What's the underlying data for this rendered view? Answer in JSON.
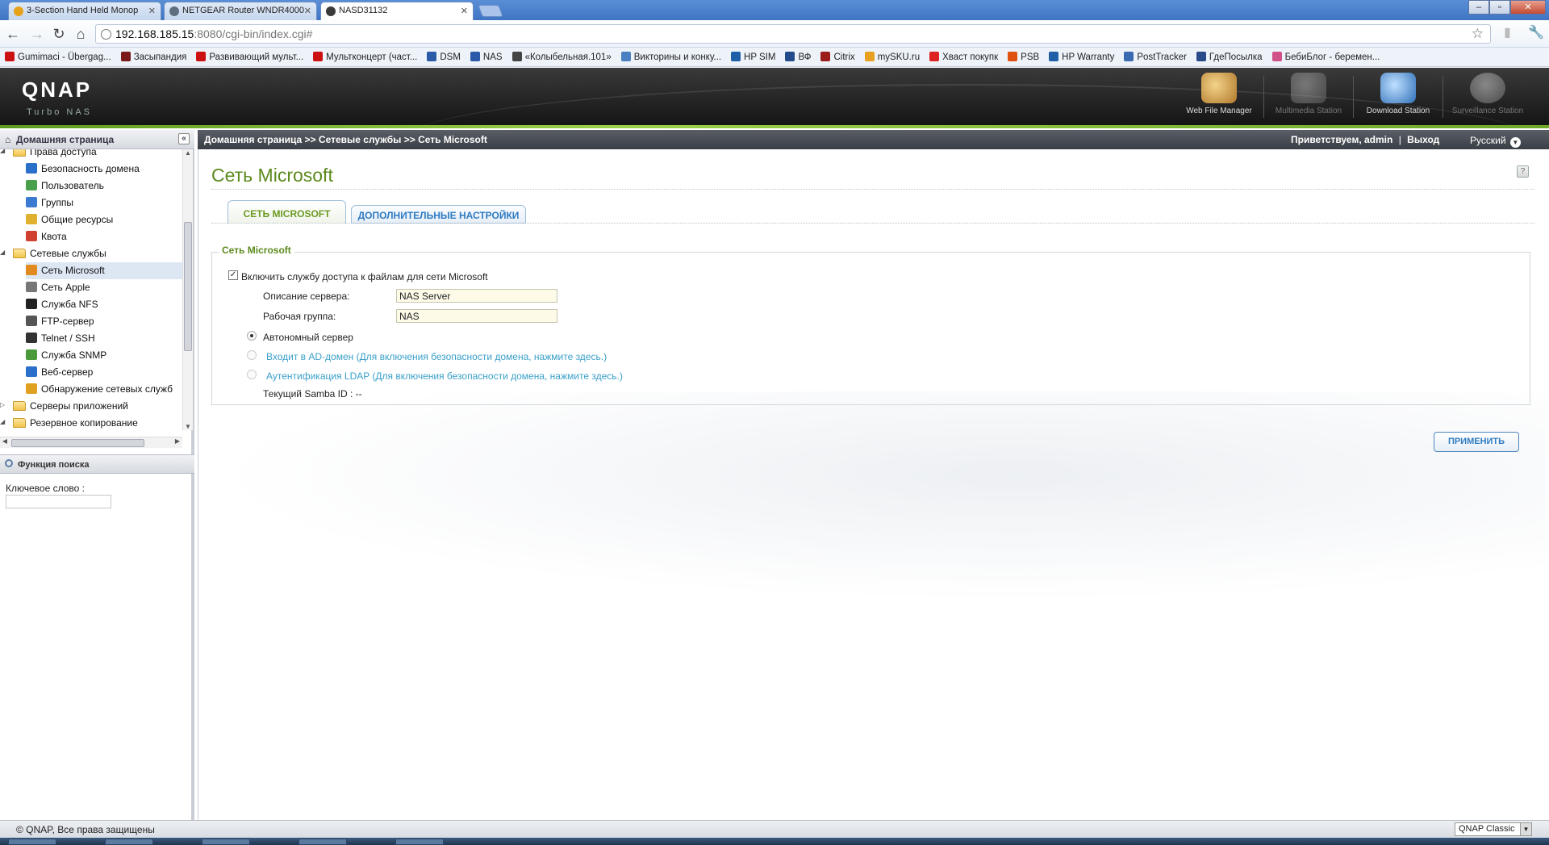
{
  "browser": {
    "tabs": [
      {
        "title": "3-Section Hand Held Monop",
        "icon_color": "#e7a21c"
      },
      {
        "title": "NETGEAR Router WNDR4000",
        "icon_color": "#5f6f80"
      },
      {
        "title": "NASD31132",
        "icon_color": "#3a3a3a"
      }
    ],
    "url_host": "192.168.185.15",
    "url_rest": ":8080/cgi-bin/index.cgi#",
    "bookmarks": [
      {
        "label": "Gumimaci - Übergag...",
        "icon_color": "#cc1111"
      },
      {
        "label": "Засыпандия",
        "icon_color": "#7a1a1a"
      },
      {
        "label": "Развивающий мульт...",
        "icon_color": "#cc1111"
      },
      {
        "label": "Мультконцерт (част...",
        "icon_color": "#cc1111"
      },
      {
        "label": "DSM",
        "icon_color": "#2a5aa8"
      },
      {
        "label": "NAS",
        "icon_color": "#2a5aa8"
      },
      {
        "label": "«Колыбельная.101»",
        "icon_color": "#444444"
      },
      {
        "label": "Викторины и конку...",
        "icon_color": "#4a7fc1"
      },
      {
        "label": "HP SIM",
        "icon_color": "#1f5fa8"
      },
      {
        "label": "ВФ",
        "icon_color": "#234a8a"
      },
      {
        "label": "Citrix",
        "icon_color": "#9c1c1c"
      },
      {
        "label": "mySKU.ru",
        "icon_color": "#e8a020"
      },
      {
        "label": "Хваст покупк",
        "icon_color": "#dd2222"
      },
      {
        "label": "PSB",
        "icon_color": "#e05010"
      },
      {
        "label": "HP Warranty",
        "icon_color": "#1f5fa8"
      },
      {
        "label": "PostTracker",
        "icon_color": "#3a6ab0"
      },
      {
        "label": "ГдеПосылка",
        "icon_color": "#2a4a8a"
      },
      {
        "label": "БебиБлог - беремен...",
        "icon_color": "#d0508a"
      }
    ]
  },
  "qnap": {
    "logo": "QNAP",
    "sub": "Turbo NAS",
    "apps": [
      {
        "label": "Web File Manager",
        "dim": false,
        "color": "#d9a441"
      },
      {
        "label": "Multimedia Station",
        "dim": true,
        "color": "#8a8a8a"
      },
      {
        "label": "Download Station",
        "dim": false,
        "color": "#4a90d9"
      },
      {
        "label": "Surveillance Station",
        "dim": true,
        "color": "#9a9a9a"
      }
    ]
  },
  "left": {
    "home": "Домашняя страница",
    "tree": [
      {
        "label": "Права доступа",
        "type": "folder",
        "level": 0,
        "expanded": true
      },
      {
        "label": "Безопасность домена",
        "type": "item",
        "level": 1,
        "icon_color": "#2a6fc9"
      },
      {
        "label": "Пользователь",
        "type": "item",
        "level": 1,
        "icon_color": "#4aa04a"
      },
      {
        "label": "Группы",
        "type": "item",
        "level": 1,
        "icon_color": "#3a7ad0"
      },
      {
        "label": "Общие ресурсы",
        "type": "item",
        "level": 1,
        "icon_color": "#e0b030"
      },
      {
        "label": "Квота",
        "type": "item",
        "level": 1,
        "icon_color": "#d04030"
      },
      {
        "label": "Сетевые службы",
        "type": "folder",
        "level": 0,
        "expanded": true
      },
      {
        "label": "Сеть Microsoft",
        "type": "item",
        "level": 1,
        "icon_color": "#e08a20",
        "selected": true
      },
      {
        "label": "Сеть Apple",
        "type": "item",
        "level": 1,
        "icon_color": "#777777"
      },
      {
        "label": "Служба NFS",
        "type": "item",
        "level": 1,
        "icon_color": "#222222"
      },
      {
        "label": "FTP-сервер",
        "type": "item",
        "level": 1,
        "icon_color": "#555555"
      },
      {
        "label": "Telnet / SSH",
        "type": "item",
        "level": 1,
        "icon_color": "#333333"
      },
      {
        "label": "Служба SNMP",
        "type": "item",
        "level": 1,
        "icon_color": "#4a9a3a"
      },
      {
        "label": "Веб-сервер",
        "type": "item",
        "level": 1,
        "icon_color": "#2a6fc9"
      },
      {
        "label": "Обнаружение сетевых служб",
        "type": "item",
        "level": 1,
        "icon_color": "#e0a020"
      },
      {
        "label": "Серверы приложений",
        "type": "folder",
        "level": 0,
        "expanded": false
      },
      {
        "label": "Резервное копирование",
        "type": "folder",
        "level": 0,
        "expanded": true
      }
    ],
    "search_title": "Функция поиска",
    "keyword_label": "Ключевое слово :",
    "keyword_value": ""
  },
  "header": {
    "breadcrumb": "Домашняя страница >> Сетевые службы >> Сеть Microsoft",
    "greeting": "Приветствуем,",
    "user": "admin",
    "separator": "|",
    "logout": "Выход",
    "language": "Русский"
  },
  "main": {
    "title": "Сеть Microsoft",
    "help": "?",
    "tabs": [
      {
        "label": "СЕТЬ MICROSOFT",
        "active": true
      },
      {
        "label": "ДОПОЛНИТЕЛЬНЫЕ НАСТРОЙКИ",
        "active": false
      }
    ],
    "section_title": "Сеть Microsoft",
    "enable_label": "Включить службу доступа к файлам для сети Microsoft",
    "enable_checked": true,
    "server_desc_label": "Описание сервера:",
    "server_desc_value": "NAS Server",
    "workgroup_label": "Рабочая группа:",
    "workgroup_value": "NAS",
    "options": [
      {
        "label": "Автономный сервер",
        "selected": true,
        "enabled": true
      },
      {
        "label": "Входит в AD-домен (Для включения безопасности домена, нажмите здесь.)",
        "selected": false,
        "enabled": false
      },
      {
        "label": "Аутентификация LDAP (Для включения безопасности домена, нажмите здесь.)",
        "selected": false,
        "enabled": false
      }
    ],
    "samba_id": "Текущий Samba ID : --",
    "apply": "ПРИМЕНИТЬ"
  },
  "footer": {
    "copyright": "© QNAP, Все права защищены",
    "theme": "QNAP Classic"
  },
  "colors": {
    "accent_green": "#5c8a1d",
    "link_blue": "#2e7bc2"
  }
}
